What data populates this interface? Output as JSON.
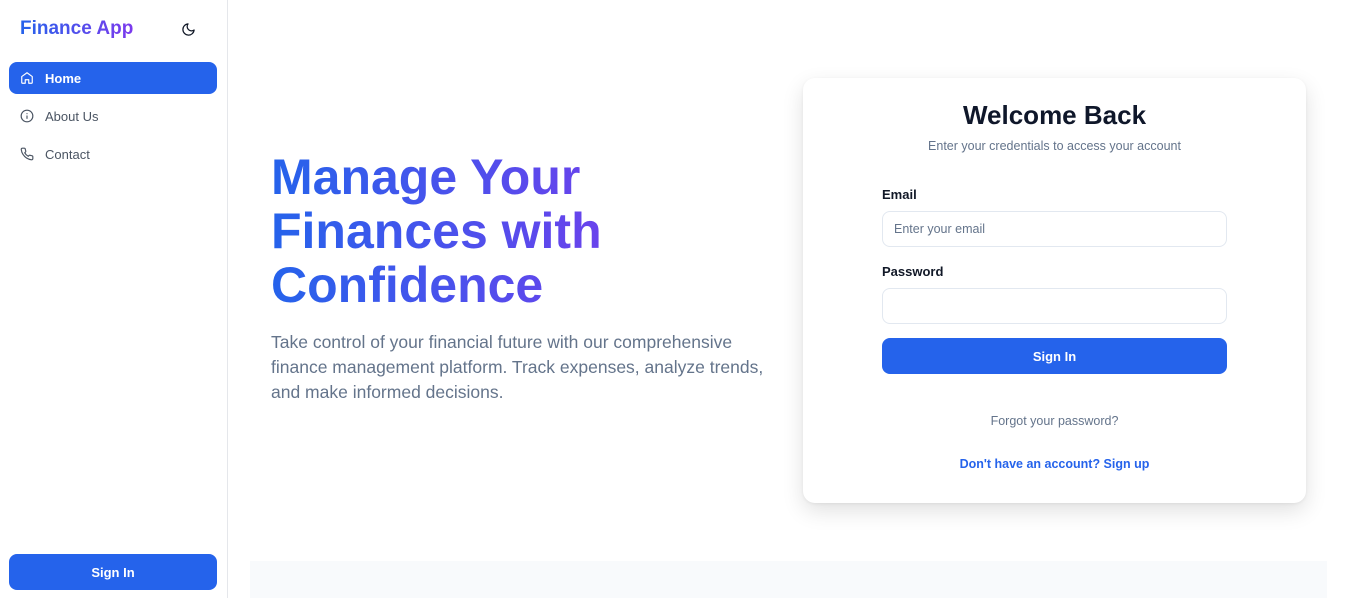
{
  "sidebar": {
    "brand": "Finance App",
    "theme_icon": "moon-icon",
    "items": [
      {
        "label": "Home",
        "icon": "home-icon",
        "active": true
      },
      {
        "label": "About Us",
        "icon": "info-icon",
        "active": false
      },
      {
        "label": "Contact",
        "icon": "phone-icon",
        "active": false
      }
    ],
    "signin_label": "Sign In"
  },
  "hero": {
    "title": "Manage Your Finances with Confidence",
    "subtitle": "Take control of your financial future with our comprehensive finance management platform. Track expenses, analyze trends, and make informed decisions."
  },
  "login": {
    "title": "Welcome Back",
    "subtitle": "Enter your credentials to access your account",
    "email_label": "Email",
    "email_placeholder": "Enter your email",
    "email_value": "",
    "password_label": "Password",
    "password_value": "",
    "signin_label": "Sign In",
    "forgot_label": "Forgot your password?",
    "signup_label": "Don't have an account? Sign up"
  },
  "colors": {
    "primary": "#2563eb",
    "gradient_end": "#7c3aed",
    "muted_text": "#64748b"
  }
}
